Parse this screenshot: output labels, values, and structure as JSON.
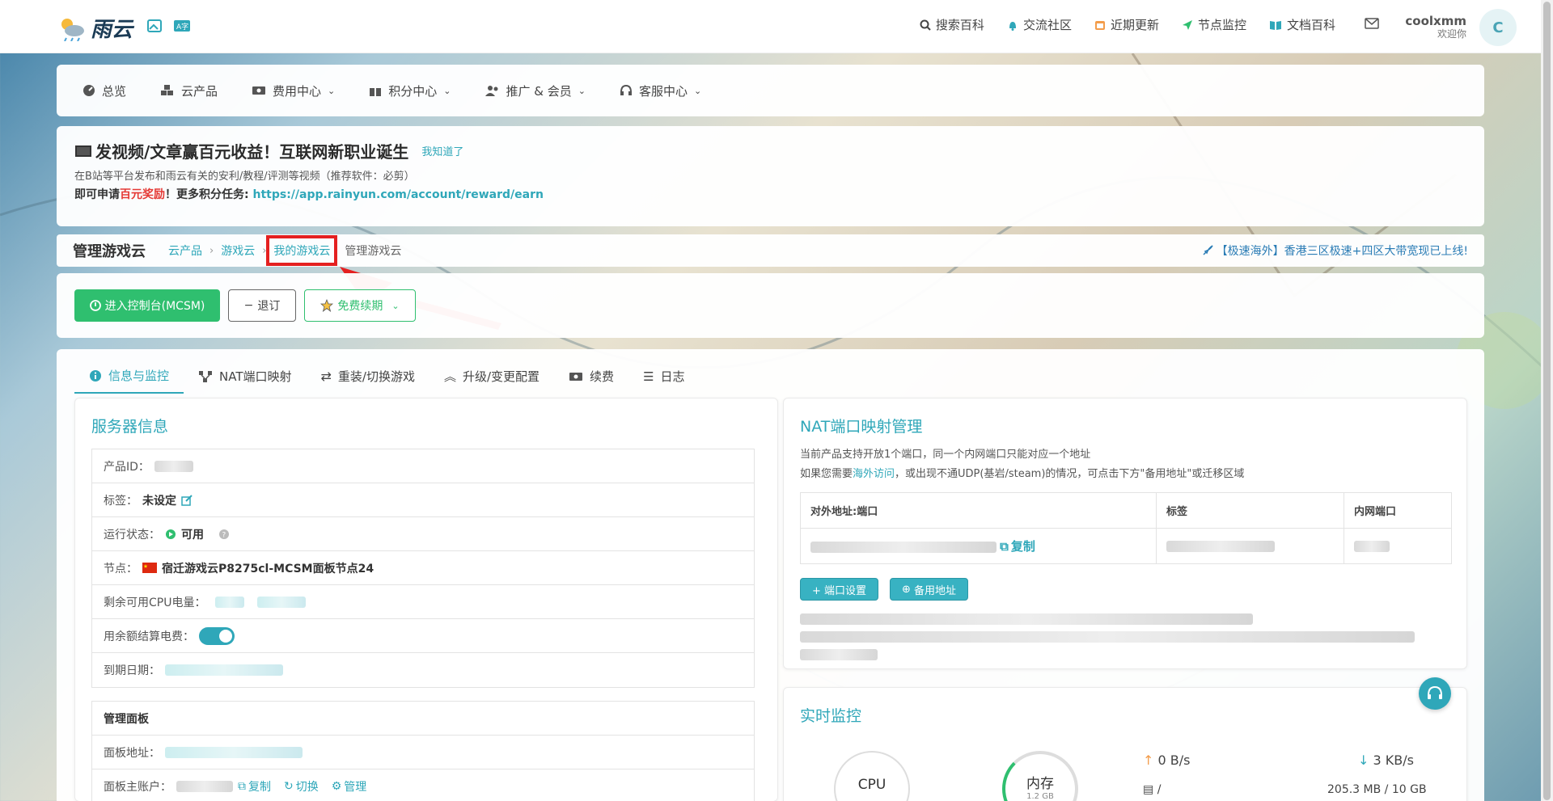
{
  "brand": {
    "name": "雨云"
  },
  "topnav": [
    {
      "icon": "search-icon",
      "label": "搜索百科"
    },
    {
      "icon": "bell-icon",
      "label": "交流社区"
    },
    {
      "icon": "calendar-icon",
      "label": "近期更新"
    },
    {
      "icon": "send-icon",
      "label": "节点监控"
    },
    {
      "icon": "book-icon",
      "label": "文档百科"
    }
  ],
  "user": {
    "name": "coolxmm",
    "subtitle": "欢迎你",
    "avatar_letter": "C"
  },
  "menu": [
    {
      "label": "总览"
    },
    {
      "label": "云产品"
    },
    {
      "label": "费用中心"
    },
    {
      "label": "积分中心"
    },
    {
      "label": "推广 & 会员"
    },
    {
      "label": "客服中心"
    }
  ],
  "notice": {
    "title": "发视频/文章赢百元收益！互联网新职业诞生",
    "got_it": "我知道了",
    "line2": "在B站等平台发布和雨云有关的安利/教程/评测等视频（推荐软件：必剪）",
    "line3_prefix": "即可申请",
    "line3_red": "百元奖励",
    "line3_mid": "！更多积分任务: ",
    "line3_link": "https://app.rainyun.com/account/reward/earn"
  },
  "breadcrumb": {
    "title": "管理游戏云",
    "items": [
      "云产品",
      "游戏云",
      "我的游戏云"
    ],
    "current": "管理游戏云",
    "announcement": "【极速海外】香港三区极速+四区大带宽现已上线!"
  },
  "actions": {
    "console": "进入控制台(MCSM)",
    "unsubscribe": "退订",
    "renew": "免费续期"
  },
  "tabs": [
    "信息与监控",
    "NAT端口映射",
    "重装/切换游戏",
    "升级/变更配置",
    "续费",
    "日志"
  ],
  "server_info": {
    "title": "服务器信息",
    "product_id_label": "产品ID：",
    "tag_label": "标签：",
    "tag_value": "未设定",
    "status_label": "运行状态：",
    "status_value": "可用",
    "node_label": "节点：",
    "node_value": "宿迁游戏云P8275cl-MCSM面板节点24",
    "cpu_label": "剩余可用CPU电量：",
    "balance_label": "用余额结算电费：",
    "expire_label": "到期日期："
  },
  "panel_info": {
    "title": "管理面板",
    "address_label": "面板地址：",
    "account_label": "面板主账户：",
    "copy": "复制",
    "switch": "切换",
    "manage": "管理"
  },
  "nat": {
    "title": "NAT端口映射管理",
    "desc1": "当前产品支持开放1个端口，同一个内网端口只能对应一个地址",
    "desc2_prefix": "如果您需要",
    "desc2_link": "海外访问",
    "desc2_suffix": "，或出现不通UDP(基岩/steam)的情况，可点击下方\"备用地址\"或迁移区域",
    "columns": [
      "对外地址:端口",
      "标签",
      "内网端口"
    ],
    "copy": "复制",
    "btn_port": "+ 端口设置",
    "btn_backup": "备用地址"
  },
  "monitor": {
    "title": "实时监控",
    "cpu": "CPU",
    "mem": "内存",
    "mem_sub": "1.2 GB",
    "up": "0 B/s",
    "down": "3 KB/s",
    "disk_prefix": "/",
    "disk": "205.3 MB / 10 GB"
  },
  "colors": {
    "accent": "#2fa7b9",
    "green": "#2fbf6f",
    "annotation": "#e42020"
  }
}
